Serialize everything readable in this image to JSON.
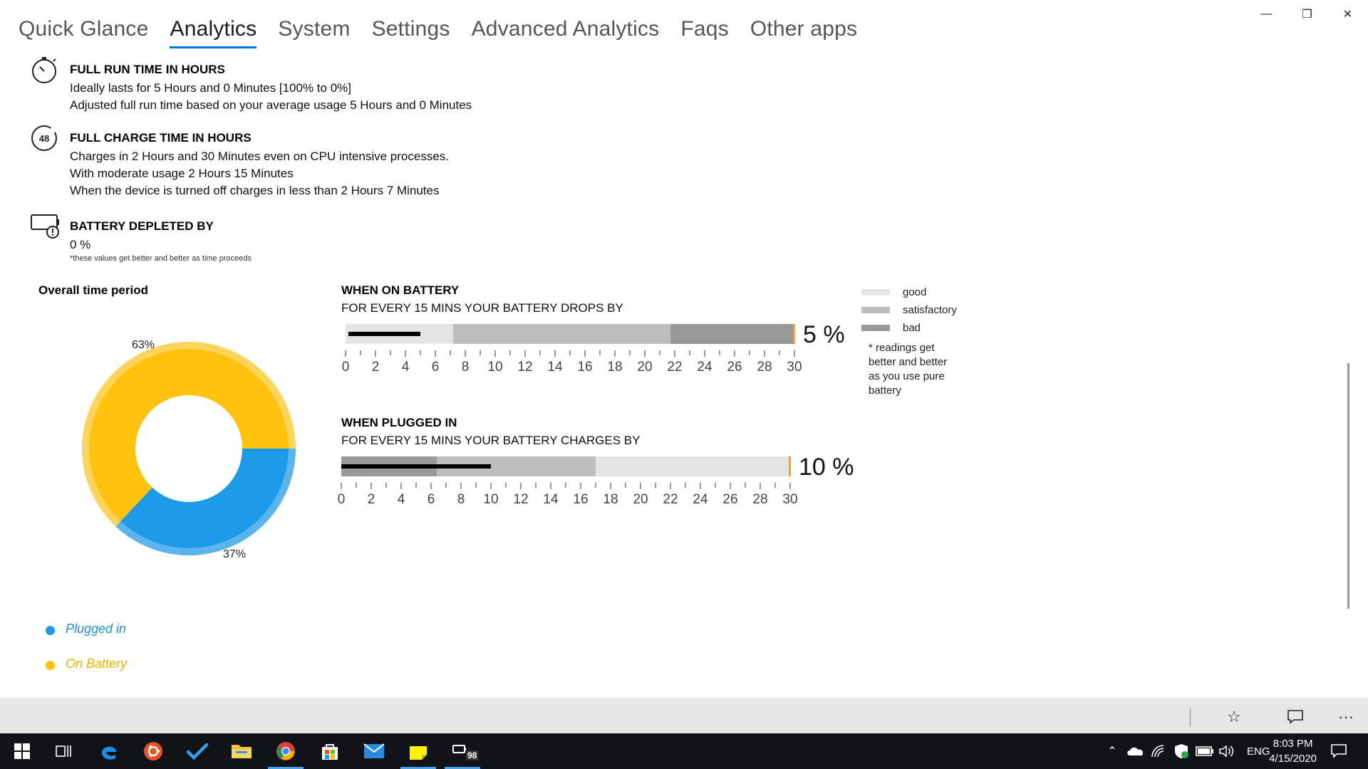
{
  "window": {
    "controls": [
      "minimize",
      "restore",
      "close"
    ],
    "minimize_glyph": "—",
    "restore_glyph": "❐",
    "close_glyph": "✕"
  },
  "tabs": [
    {
      "label": "Quick Glance",
      "active": false
    },
    {
      "label": "Analytics",
      "active": true
    },
    {
      "label": "System",
      "active": false
    },
    {
      "label": "Settings",
      "active": false
    },
    {
      "label": "Advanced Analytics",
      "active": false
    },
    {
      "label": "Faqs",
      "active": false
    },
    {
      "label": "Other apps",
      "active": false
    }
  ],
  "run_time": {
    "icon": "stopwatch-icon",
    "title": "FULL RUN TIME IN HOURS",
    "line1": "Ideally lasts for 5 Hours and 0 Minutes [100% to 0%]",
    "line2": "Adjusted full run time based on your average usage 5 Hours and 0 Minutes"
  },
  "charge_time": {
    "icon": "timer-48-icon",
    "icon_text": "48",
    "title": "FULL CHARGE TIME IN HOURS",
    "line1": "Charges in 2 Hours and 30 Minutes even on CPU intensive processes.",
    "line2": "With moderate usage 2 Hours 15 Minutes",
    "line3": "When the device is turned off charges in less than 2 Hours 7 Minutes"
  },
  "depleted": {
    "icon": "battery-warning-icon",
    "title": "BATTERY DEPLETED BY",
    "value": "0 %",
    "note": "*these values get better and better as time proceeds"
  },
  "overall": {
    "title": "Overall time period",
    "on_battery_pct_label": "63%",
    "plugged_pct_label": "37%",
    "legend_plugged": "Plugged in",
    "legend_battery": "On Battery",
    "color_plugged": "#1e9be8",
    "color_battery": "#ffc20e"
  },
  "chart_data": {
    "type": "pie",
    "categories": [
      "On Battery",
      "Plugged in"
    ],
    "values": [
      63,
      37
    ],
    "labels": [
      "63%",
      "37%"
    ],
    "colors": [
      "#ffc20e",
      "#1e9be8"
    ]
  },
  "on_battery": {
    "title": "WHEN ON BATTERY",
    "subtitle": "FOR EVERY 15 MINS YOUR BATTERY DROPS BY",
    "value": 5,
    "value_text": "5 %",
    "needle_value": 5,
    "zones": [
      {
        "from": 0,
        "to": 7.2,
        "zone": "good"
      },
      {
        "from": 7.2,
        "to": 21.7,
        "zone": "satisfactory"
      },
      {
        "from": 21.7,
        "to": 30,
        "zone": "bad"
      }
    ],
    "ticks": [
      "0",
      "2",
      "4",
      "6",
      "8",
      "10",
      "12",
      "14",
      "16",
      "18",
      "20",
      "22",
      "24",
      "26",
      "28",
      "30"
    ]
  },
  "plugged_in": {
    "title": "WHEN PLUGGED IN",
    "subtitle": "FOR EVERY 15 MINS YOUR BATTERY CHARGES BY",
    "value": 10,
    "value_text": "10 %",
    "needle_value": 10,
    "zones": [
      {
        "from": 0,
        "to": 6.4,
        "zone": "bad"
      },
      {
        "from": 6.4,
        "to": 17,
        "zone": "satisfactory"
      },
      {
        "from": 17,
        "to": 30,
        "zone": "good"
      }
    ],
    "ticks": [
      "0",
      "2",
      "4",
      "6",
      "8",
      "10",
      "12",
      "14",
      "16",
      "18",
      "20",
      "22",
      "24",
      "26",
      "28",
      "30"
    ]
  },
  "legend": {
    "good": "good",
    "satisfactory": "satisfactory",
    "bad": "bad",
    "note": "* readings get better and better as you use pure battery",
    "colors": {
      "good": "#e4e4e4",
      "satisfactory": "#bdbdbd",
      "bad": "#999999"
    }
  },
  "appbar": {
    "pin_icon": "star-icon",
    "feedback_icon": "chat-icon",
    "more_icon": "more-icon",
    "pin_glyph": "☆",
    "more_glyph": "···"
  },
  "taskbar": {
    "apps": [
      "start-icon",
      "task-view-icon",
      "edge-icon",
      "ubuntu-icon",
      "todo-icon",
      "file-explorer-icon",
      "chrome-icon",
      "store-icon",
      "mail-icon",
      "sticky-notes-icon",
      "battery-app-icon"
    ],
    "badge": "98",
    "lang": "ENG",
    "time": "8:03 PM",
    "date": "4/15/2020"
  }
}
